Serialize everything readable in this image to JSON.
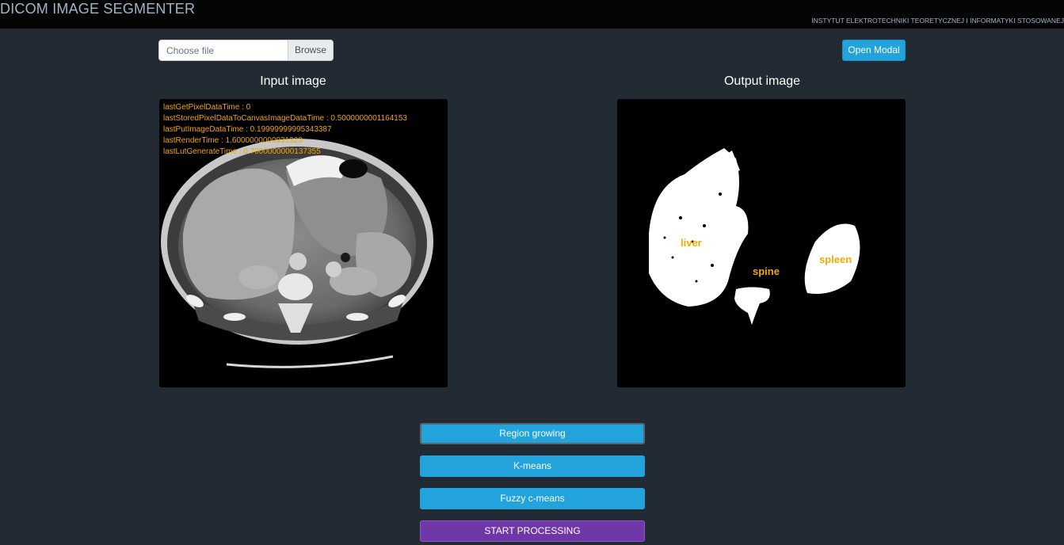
{
  "header": {
    "title": "DICOM IMAGE SEGMENTER",
    "institute": "INSTYTUT ELEKTROTECHNIKI TEORETYCZNEJ I INFORMATYKI STOSOWANEJ"
  },
  "file_input": {
    "placeholder": "Choose file",
    "browse_label": "Browse"
  },
  "open_modal_label": "Open Modal",
  "input_panel": {
    "title": "Input image",
    "stats": [
      "lastGetPixelDataTime : 0",
      "lastStoredPixelDataToCanvasImageDataTime : 0.5000000001164153",
      "lastPutImageDataTime : 0.19999999995343387",
      "lastRenderTime : 1.6000000000931323",
      "lastLutGenerateTime : 0.7000000000137355"
    ]
  },
  "output_panel": {
    "title": "Output image",
    "labels": {
      "liver": "liver",
      "spine": "spine",
      "spleen": "spleen"
    }
  },
  "buttons": {
    "region_growing": "Region growing",
    "kmeans": "K-means",
    "fuzzy": "Fuzzy c-means",
    "start": "START PROCESSING"
  },
  "colors": {
    "accent_blue": "#22a3dc",
    "start_purple": "#6f36a8",
    "label_orange": "#f2a900",
    "background": "#222b33"
  }
}
